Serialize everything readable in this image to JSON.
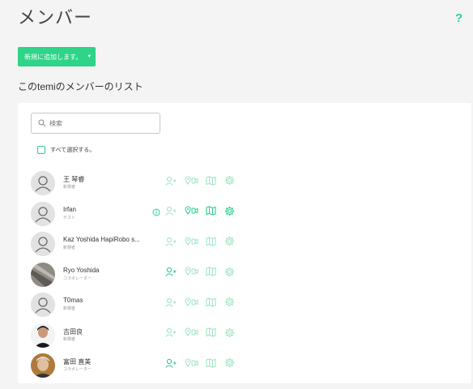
{
  "header": {
    "title": "メンバー",
    "help_label": "?",
    "add_button_label": "新規に追加します。",
    "list_heading": "このtemiのメンバーのリスト"
  },
  "search": {
    "placeholder": "検索"
  },
  "select_all_label": "すべて選択する。",
  "colors": {
    "accent": "#2ecf8c",
    "accent_light": "#9fe6c3",
    "button": "#2ed488"
  },
  "members": [
    {
      "name": "王 琴睿",
      "role": "新規者",
      "avatar": "placeholder-avatar",
      "info": false,
      "active": "faded"
    },
    {
      "name": "Irfan",
      "role": "ゲスト",
      "avatar": "placeholder-avatar",
      "info": true,
      "active": "mixed"
    },
    {
      "name": "Kaz Yoshida HapiRobo s...",
      "role": "新規者",
      "avatar": "placeholder-avatar",
      "info": false,
      "active": "faded"
    },
    {
      "name": "Ryo Yoshida",
      "role": "コラボレーター",
      "avatar": "photo-avatar",
      "info": false,
      "active": "partial"
    },
    {
      "name": "T0mas",
      "role": "新規者",
      "avatar": "placeholder-avatar",
      "info": false,
      "active": "faded"
    },
    {
      "name": "吉田良",
      "role": "新規者",
      "avatar": "photo-avatar",
      "info": false,
      "active": "faded"
    },
    {
      "name": "富田 直美",
      "role": "コラボレーター",
      "avatar": "photo-avatar",
      "info": false,
      "active": "partial"
    }
  ]
}
